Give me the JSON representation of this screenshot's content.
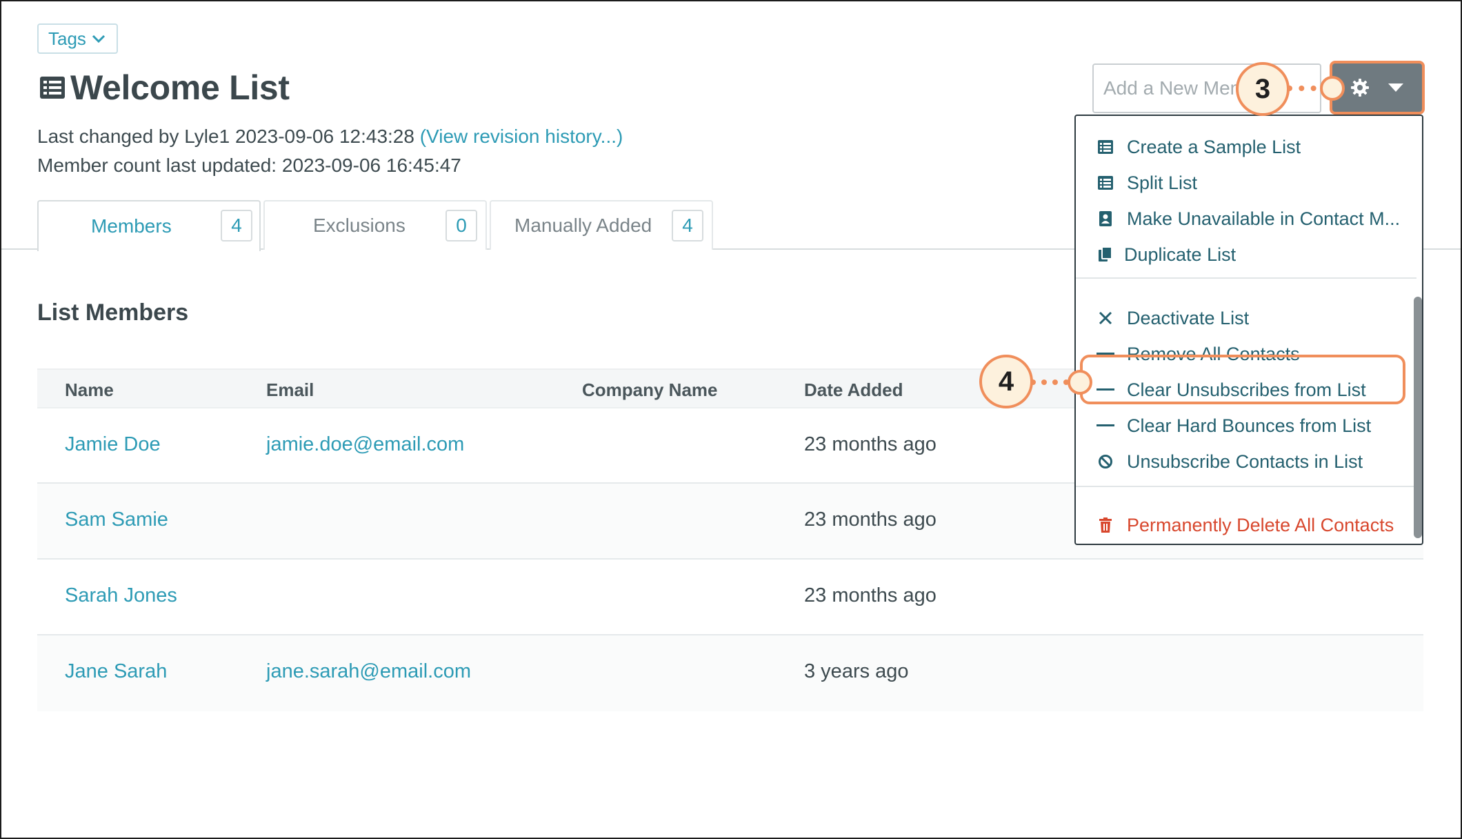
{
  "header": {
    "tags_label": "Tags",
    "title": "Welcome List",
    "last_changed_text": "Last changed by Lyle1 2023-09-06 12:43:28",
    "revision_link": "(View revision history...)",
    "member_count_text": "Member count last updated: 2023-09-06 16:45:47",
    "add_member_placeholder": "Add a New Member"
  },
  "tabs": [
    {
      "label": "Members",
      "count": "4",
      "active": true
    },
    {
      "label": "Exclusions",
      "count": "0",
      "active": false
    },
    {
      "label": "Manually Added",
      "count": "4",
      "active": false
    }
  ],
  "section": {
    "title": "List Members",
    "columns": [
      "Name",
      "Email",
      "Company Name",
      "Date Added"
    ]
  },
  "members": [
    {
      "name": "Jamie Doe",
      "email": "jamie.doe@email.com",
      "company": "",
      "date_added": "23 months ago"
    },
    {
      "name": "Sam Samie",
      "email": "",
      "company": "",
      "date_added": "23 months ago"
    },
    {
      "name": "Sarah Jones",
      "email": "",
      "company": "",
      "date_added": "23 months ago"
    },
    {
      "name": "Jane Sarah",
      "email": "jane.sarah@email.com",
      "company": "",
      "date_added": "3 years ago"
    }
  ],
  "menu": {
    "group1": [
      {
        "label": "Create a Sample List",
        "icon": "list-icon"
      },
      {
        "label": "Split List",
        "icon": "list-icon"
      },
      {
        "label": "Make Unavailable in Contact M...",
        "icon": "contact-book-icon"
      },
      {
        "label": "Duplicate List",
        "icon": "copy-icon"
      }
    ],
    "group2": [
      {
        "label": "Deactivate List",
        "icon": "close-icon"
      },
      {
        "label": "Remove All Contacts",
        "icon": "minus-icon"
      },
      {
        "label": "Clear Unsubscribes from List",
        "icon": "minus-icon"
      },
      {
        "label": "Clear Hard Bounces from List",
        "icon": "minus-icon"
      },
      {
        "label": "Unsubscribe Contacts in List",
        "icon": "ban-icon"
      }
    ],
    "group3": [
      {
        "label": "Permanently Delete All Contacts",
        "icon": "trash-icon"
      }
    ]
  },
  "callouts": {
    "step_a": "3",
    "step_b": "4"
  },
  "colors": {
    "accent": "#2d9bb5",
    "callout": "#f08e5b",
    "danger": "#d8472d",
    "button": "#6f7a80"
  }
}
